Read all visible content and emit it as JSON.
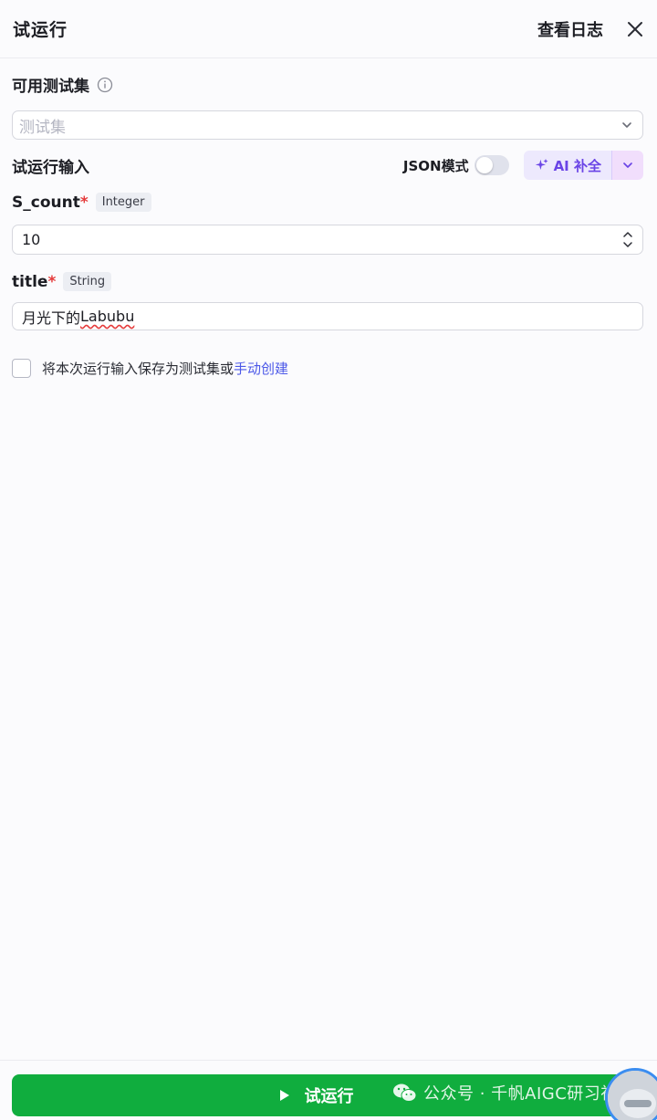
{
  "header": {
    "title": "试运行",
    "view_log_label": "查看日志"
  },
  "test_set": {
    "label": "可用测试集",
    "placeholder": "测试集"
  },
  "input_section": {
    "title": "试运行输入",
    "json_mode_label": "JSON模式",
    "json_mode_enabled": false,
    "ai_fill_label": "AI 补全"
  },
  "fields": [
    {
      "name": "S_count",
      "required_mark": "*",
      "type": "Integer",
      "value": "10"
    },
    {
      "name": "title",
      "required_mark": "*",
      "type": "String",
      "value_prefix": "月光下的",
      "value_suffix": "Labubu"
    }
  ],
  "save_option": {
    "checked": false,
    "text": "将本次运行输入保存为测试集或",
    "link_text": "手动创建"
  },
  "footer": {
    "run_label": "试运行",
    "watermark": "公众号 · 千帆AIGC研习社"
  },
  "colors": {
    "primary_green": "#10ad3e",
    "ai_purple": "#6a44e6",
    "link_blue": "#4c58e8",
    "required_red": "#e53b3b"
  },
  "icons": {
    "close": "close-icon",
    "info": "info-icon",
    "dropdown": "chevron-down-icon",
    "ai": "sparkle-icon",
    "run": "play-icon"
  }
}
